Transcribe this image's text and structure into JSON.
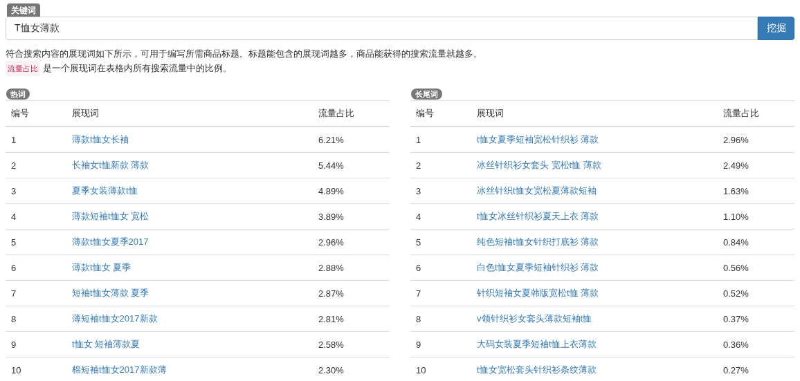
{
  "search": {
    "label": "关键词",
    "value": "T恤女薄款",
    "button": "挖掘"
  },
  "intro": "符合搜索内容的展现词如下所示，可用于编写所需商品标题。标题能包含的展现词越多，商品能获得的搜索流量就越多。",
  "note": {
    "tag": "流量占比",
    "text": "是一个展现词在表格内所有搜索流量中的比例。"
  },
  "tables": [
    {
      "badge": "热词",
      "columns": [
        "编号",
        "展现词",
        "流量占比"
      ],
      "rows": [
        [
          "1",
          "薄款t恤女长袖",
          "6.21%"
        ],
        [
          "2",
          "长袖女t恤新款 薄款",
          "5.44%"
        ],
        [
          "3",
          "夏季女装薄款t恤",
          "4.89%"
        ],
        [
          "4",
          "薄款短袖t恤女 宽松",
          "3.89%"
        ],
        [
          "5",
          "薄款t恤女夏季2017",
          "2.96%"
        ],
        [
          "6",
          "薄款t恤女 夏季",
          "2.88%"
        ],
        [
          "7",
          "短袖t恤女薄款 夏季",
          "2.87%"
        ],
        [
          "8",
          "薄短袖t恤女2017新款",
          "2.81%"
        ],
        [
          "9",
          "t恤女 短袖薄款夏",
          "2.58%"
        ],
        [
          "10",
          "棉短袖t恤女2017新款薄",
          "2.30%"
        ]
      ]
    },
    {
      "badge": "长尾词",
      "columns": [
        "编号",
        "展现词",
        "流量占比"
      ],
      "rows": [
        [
          "1",
          "t恤女夏季短袖宽松针织衫 薄款",
          "2.96%"
        ],
        [
          "2",
          "冰丝针织衫女套头 宽松t恤 薄款",
          "2.49%"
        ],
        [
          "3",
          "冰丝针织t恤女宽松夏薄款短袖",
          "1.63%"
        ],
        [
          "4",
          "t恤女冰丝针织衫夏天上衣 薄款",
          "1.10%"
        ],
        [
          "5",
          "纯色短袖t恤女针织打底衫 薄款",
          "0.84%"
        ],
        [
          "6",
          "白色t恤女夏季短袖针织衫 薄款",
          "0.56%"
        ],
        [
          "7",
          "针织短袖女夏韩版宽松t恤 薄款",
          "0.52%"
        ],
        [
          "8",
          "v领针织衫女套头薄款短袖t恤",
          "0.37%"
        ],
        [
          "9",
          "大码女装夏季短袖t恤上衣薄款",
          "0.36%"
        ],
        [
          "10",
          "t恤女宽松套头针织衫条纹薄款",
          "0.27%"
        ]
      ]
    }
  ]
}
